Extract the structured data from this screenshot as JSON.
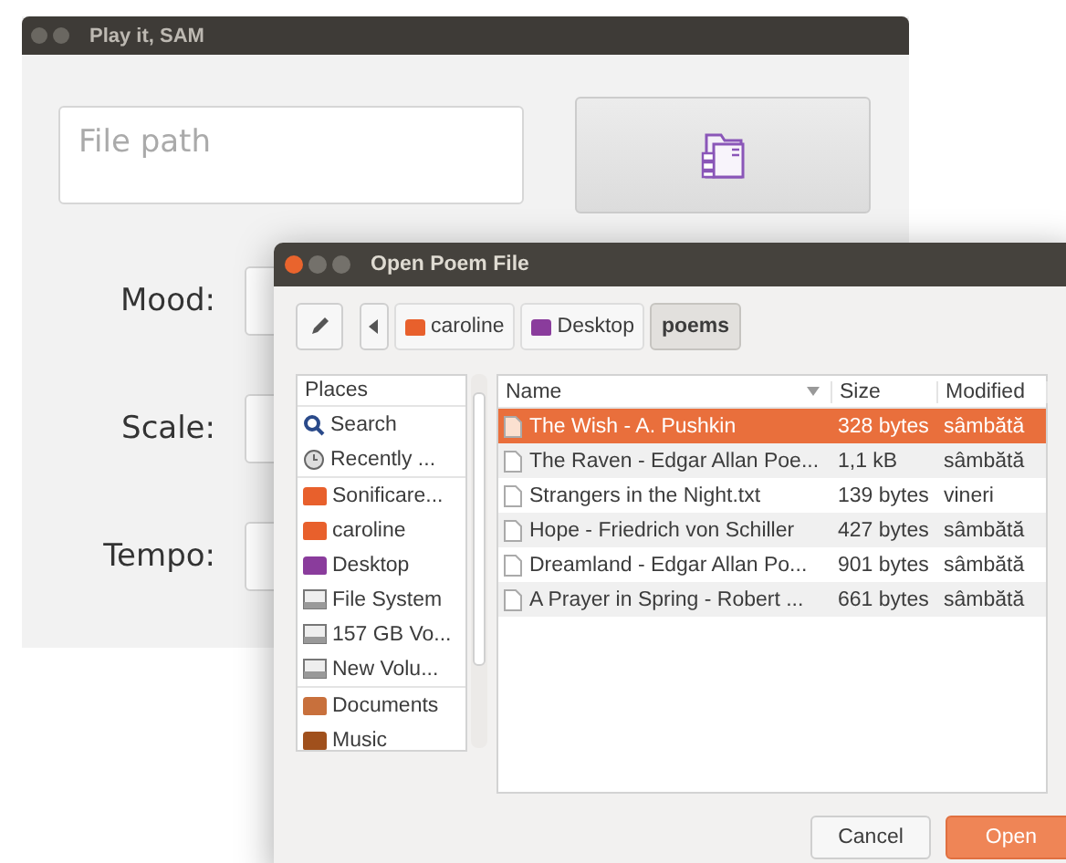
{
  "main_window": {
    "title": "Play it, SAM",
    "file_path": {
      "placeholder": "File path"
    },
    "fields": [
      {
        "label": "Mood:"
      },
      {
        "label": "Scale:"
      },
      {
        "label": "Tempo:"
      }
    ]
  },
  "dialog": {
    "title": "Open Poem File",
    "path": [
      {
        "label": "caroline",
        "kind": "home",
        "selected": false
      },
      {
        "label": "Desktop",
        "kind": "desktop",
        "selected": false
      },
      {
        "label": "poems",
        "kind": "plain",
        "selected": true
      }
    ],
    "places_heading": "Places",
    "places": [
      {
        "label": "Search",
        "kind": "search"
      },
      {
        "label": "Recently ...",
        "kind": "recent"
      },
      {
        "label": "Sonificare...",
        "kind": "folder"
      },
      {
        "label": "caroline",
        "kind": "home"
      },
      {
        "label": "Desktop",
        "kind": "desktop"
      },
      {
        "label": "File System",
        "kind": "drive"
      },
      {
        "label": "157 GB Vo...",
        "kind": "drive"
      },
      {
        "label": "New Volu...",
        "kind": "drive"
      },
      {
        "label": "Documents",
        "kind": "documents"
      },
      {
        "label": "Music",
        "kind": "music"
      }
    ],
    "columns": [
      "Name",
      "Size",
      "Modified"
    ],
    "files": [
      {
        "name": "The Wish - A. Pushkin",
        "size": "328 bytes",
        "modified": "sâmbătă",
        "selected": true
      },
      {
        "name": "The Raven - Edgar Allan Poe...",
        "size": "1,1 kB",
        "modified": "sâmbătă",
        "selected": false
      },
      {
        "name": "Strangers in the Night.txt",
        "size": "139 bytes",
        "modified": "vineri",
        "selected": false
      },
      {
        "name": "Hope - Friedrich von Schiller",
        "size": "427 bytes",
        "modified": "sâmbătă",
        "selected": false
      },
      {
        "name": "Dreamland - Edgar Allan Po...",
        "size": "901 bytes",
        "modified": "sâmbătă",
        "selected": false
      },
      {
        "name": "A Prayer in Spring - Robert ...",
        "size": "661 bytes",
        "modified": "sâmbătă",
        "selected": false
      }
    ],
    "buttons": [
      "Cancel",
      "Open"
    ]
  }
}
